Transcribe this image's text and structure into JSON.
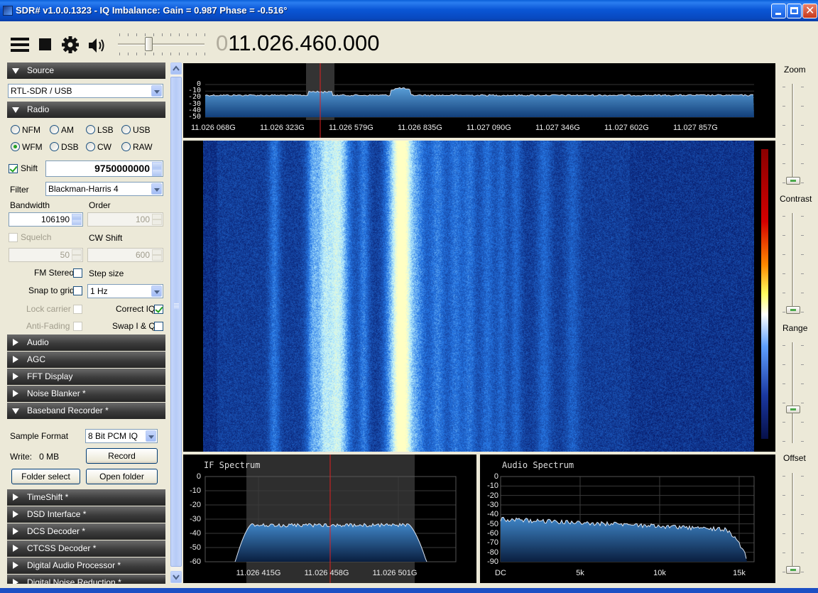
{
  "window": {
    "title": "SDR# v1.0.0.1323 - IQ Imbalance: Gain = 0.987 Phase = -0.516°"
  },
  "toolbar": {
    "frequency_dim": "0",
    "frequency": "11.026.460.000",
    "volume_level": 0.33
  },
  "source": {
    "header": "Source",
    "device": "RTL-SDR / USB"
  },
  "radio": {
    "header": "Radio",
    "modes": [
      "NFM",
      "AM",
      "LSB",
      "USB",
      "WFM",
      "DSB",
      "CW",
      "RAW"
    ],
    "selected_mode": "WFM",
    "shift_label": "Shift",
    "shift_checked": true,
    "shift_value": "9750000000",
    "filter_label": "Filter",
    "filter_value": "Blackman-Harris 4",
    "bandwidth_label": "Bandwidth",
    "bandwidth_value": "106190",
    "order_label": "Order",
    "order_value": "100",
    "squelch_label": "Squelch",
    "squelch_value": "50",
    "cw_shift_label": "CW Shift",
    "cw_shift_value": "600",
    "fm_stereo_label": "FM Stereo",
    "step_size_label": "Step size",
    "snap_to_grid_label": "Snap to grid",
    "step_size_value": "1 Hz",
    "lock_carrier_label": "Lock carrier",
    "correct_iq_label": "Correct IQ",
    "correct_iq_checked": true,
    "anti_fading_label": "Anti-Fading",
    "swap_iq_label": "Swap I & Q"
  },
  "panels": {
    "audio": "Audio",
    "agc": "AGC",
    "fft_display": "FFT Display",
    "noise_blanker": "Noise Blanker *",
    "baseband_recorder": "Baseband Recorder *",
    "timeshift": "TimeShift *",
    "dsd_interface": "DSD Interface *",
    "dcs_decoder": "DCS Decoder *",
    "ctcss_decoder": "CTCSS Decoder *",
    "digital_audio_processor": "Digital Audio Processor *",
    "digital_noise_reduction": "Digital Noise Reduction *"
  },
  "recorder": {
    "sample_format_label": "Sample Format",
    "sample_format_value": "8 Bit PCM IQ",
    "write_label": "Write:",
    "write_value": "0 MB",
    "record_button": "Record",
    "folder_select_button": "Folder select",
    "open_folder_button": "Open folder"
  },
  "main_spectrum": {
    "y_ticks": [
      "0",
      "-10",
      "-20",
      "-30",
      "-40",
      "-50"
    ],
    "x_ticks": [
      "11.026 068G",
      "11.026 323G",
      "11.026 579G",
      "11.026 835G",
      "11.027 090G",
      "11.027 346G",
      "11.027 602G",
      "11.027 857G"
    ]
  },
  "if_spectrum": {
    "title": "IF Spectrum",
    "y_ticks": [
      "0",
      "-10",
      "-20",
      "-30",
      "-40",
      "-50",
      "-60"
    ],
    "x_ticks": [
      "11.026 415G",
      "11.026 458G",
      "11.026 501G"
    ]
  },
  "audio_spectrum": {
    "title": "Audio Spectrum",
    "y_ticks": [
      "0",
      "-10",
      "-20",
      "-30",
      "-40",
      "-50",
      "-60",
      "-70",
      "-80",
      "-90"
    ],
    "x_ticks": [
      "DC",
      "5k",
      "10k",
      "15k"
    ]
  },
  "right_controls": {
    "zoom_label": "Zoom",
    "contrast_label": "Contrast",
    "range_label": "Range",
    "offset_label": "Offset",
    "zoom_level": 0.0,
    "contrast_level": 0.0,
    "range_level": 0.32,
    "offset_level": 0.0
  },
  "colors": {
    "title_bar": "#0a56d6",
    "panel_header": "#3b3b3b",
    "spectrum_fill": "#2f74b8",
    "tuning_line": "#e02020",
    "window_bg": "#ece9d8"
  }
}
